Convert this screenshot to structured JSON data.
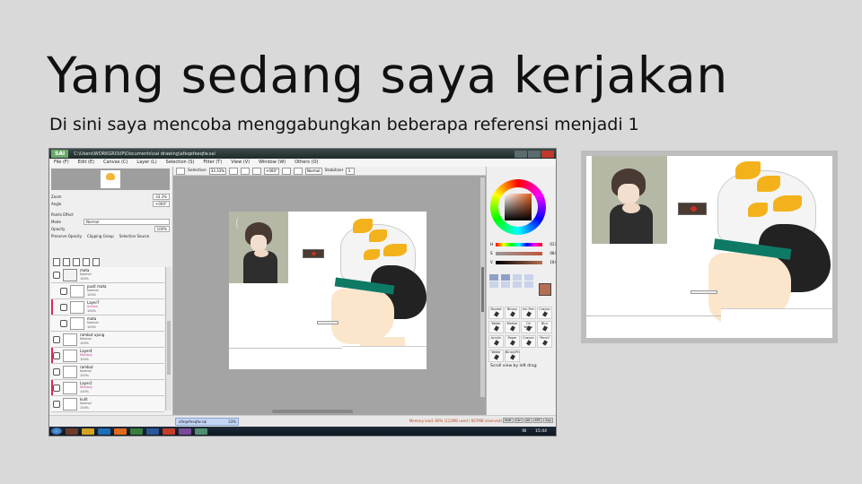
{
  "slide": {
    "title": "Yang sedang saya kerjakan",
    "subtitle": "Di sini saya mencoba menggabungkan beberapa referensi menjadi 1"
  },
  "sai": {
    "app_name": "SAI",
    "window_path": "C:\\Users\\WORKGROUP\\Documents\\sai drawing\\afeqefeeqfw.sai",
    "menu": [
      "File (F)",
      "Edit (E)",
      "Canvas (C)",
      "Layer (L)",
      "Selection (S)",
      "Filter (T)",
      "View (V)",
      "Window (W)",
      "Others (O)"
    ],
    "navigator": {
      "zoom_label": "Zoom",
      "zoom_value": "33.3%",
      "angle_label": "Angle",
      "angle_value": "+000°"
    },
    "layer_props": {
      "paint_effect": "Paints Effect",
      "mode_label": "Mode",
      "mode_value": "Normal",
      "opacity_label": "Opacity",
      "opacity_value": "100%",
      "preserve_opacity": "Preserve Opacity",
      "clipping_group": "Clipping Group",
      "selection_source": "Selection Source"
    },
    "layers": [
      {
        "name": "mata",
        "mode": "Normal",
        "opacity": "100%",
        "folder": true
      },
      {
        "name": "pusit mata",
        "mode": "Normal",
        "opacity": "100%"
      },
      {
        "name": "Layer7",
        "mode": "Screen",
        "opacity": "100%",
        "clip": true
      },
      {
        "name": "mata",
        "mode": "Normal",
        "opacity": "100%"
      },
      {
        "name": "rambut ujung",
        "mode": "Normal",
        "opacity": "100%"
      },
      {
        "name": "Layer4",
        "mode": "Multiply",
        "opacity": "100%",
        "clip": true
      },
      {
        "name": "rambut",
        "mode": "Normal",
        "opacity": "100%"
      },
      {
        "name": "Layer2",
        "mode": "Multiply",
        "opacity": "100%",
        "clip": true
      },
      {
        "name": "kulit",
        "mode": "Normal",
        "opacity": "100%"
      }
    ],
    "canvas_toolbar": {
      "selection_label": "Selection",
      "zoom_value": "33.33%",
      "angle_value": "+000°",
      "blend_value": "Normal",
      "stabilizer_label": "Stabilizer",
      "stabilizer_value": "3"
    },
    "color": {
      "h_label": "H",
      "h_value": "017",
      "s_label": "S",
      "s_value": "064",
      "v_label": "V",
      "v_value": "164",
      "current_color": "#b56f55"
    },
    "brushes": [
      "Bucket",
      "Binary",
      "Ink Pen",
      "Crayon",
      "Water",
      "Marker",
      "Oil Water",
      "Blur",
      "Acrylic",
      "Paper",
      "Crayon",
      "Pencil",
      "Water",
      "BinaryPn"
    ],
    "hint": "Scroll view by left drag",
    "status": {
      "tab_name": "afeqefeeqfw.sai",
      "tab_zoom": "33%",
      "memory": "Memory load: 80% (112MB used / 667MB reserved)",
      "keys": [
        "Shift",
        "Ctrl",
        "Alt",
        "SPC",
        "Any"
      ]
    },
    "taskbar": {
      "lang": "IN",
      "time": "15:44"
    }
  },
  "colors": {
    "background": "#d9d9d9",
    "accent_yellow": "#f3b21c",
    "accent_green": "#0e7a66",
    "layer_marker": "#d22d5a"
  }
}
